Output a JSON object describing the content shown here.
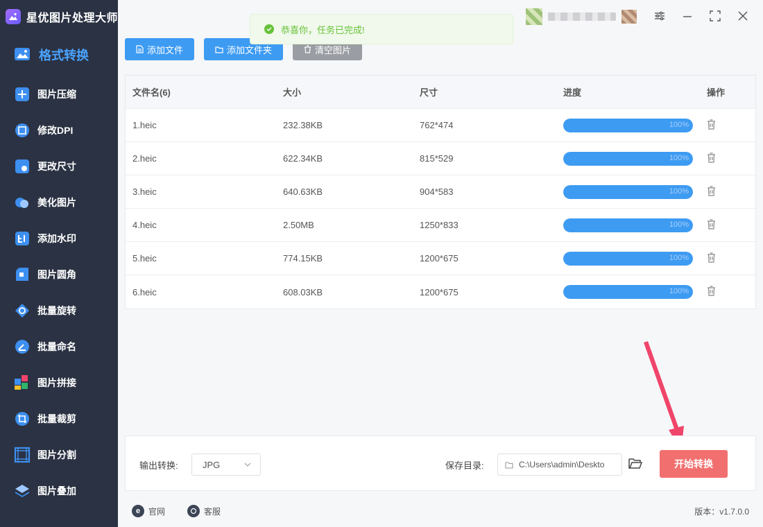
{
  "app": {
    "title": "星优图片处理大师"
  },
  "sidebar": {
    "items": [
      {
        "label": "格式转换",
        "icon": "image-convert-icon",
        "color": "#4aa3ff"
      },
      {
        "label": "图片压缩",
        "icon": "image-compress-icon",
        "color": "#3d9bf2"
      },
      {
        "label": "修改DPI",
        "icon": "dpi-icon",
        "color": "#3d9bf2"
      },
      {
        "label": "更改尺寸",
        "icon": "resize-icon",
        "color": "#3d9bf2"
      },
      {
        "label": "美化图片",
        "icon": "beautify-icon",
        "color": "#3d9bf2"
      },
      {
        "label": "添加水印",
        "icon": "watermark-icon",
        "color": "#3d9bf2"
      },
      {
        "label": "图片圆角",
        "icon": "rounded-corner-icon",
        "color": "#3d9bf2"
      },
      {
        "label": "批量旋转",
        "icon": "rotate-icon",
        "color": "#3d9bf2"
      },
      {
        "label": "批量命名",
        "icon": "rename-icon",
        "color": "#3d9bf2"
      },
      {
        "label": "图片拼接",
        "icon": "puzzle-icon",
        "color": "#3d9bf2"
      },
      {
        "label": "批量裁剪",
        "icon": "crop-icon",
        "color": "#3d9bf2"
      },
      {
        "label": "图片分割",
        "icon": "split-icon",
        "color": "#3d9bf2"
      },
      {
        "label": "图片叠加",
        "icon": "layers-icon",
        "color": "#3d9bf2"
      }
    ]
  },
  "toast": {
    "message": "恭喜你，任务已完成!"
  },
  "toolbar": {
    "add_file": "添加文件",
    "add_folder": "添加文件夹",
    "clear": "清空图片"
  },
  "table": {
    "headers": {
      "name": "文件名(6)",
      "size": "大小",
      "dimensions": "尺寸",
      "progress": "进度",
      "action": "操作"
    },
    "rows": [
      {
        "name": "1.heic",
        "size": "232.38KB",
        "dimensions": "762*474",
        "progress": "100%"
      },
      {
        "name": "2.heic",
        "size": "622.34KB",
        "dimensions": "815*529",
        "progress": "100%"
      },
      {
        "name": "3.heic",
        "size": "640.63KB",
        "dimensions": "904*583",
        "progress": "100%"
      },
      {
        "name": "4.heic",
        "size": "2.50MB",
        "dimensions": "1250*833",
        "progress": "100%"
      },
      {
        "name": "5.heic",
        "size": "774.15KB",
        "dimensions": "1200*675",
        "progress": "100%"
      },
      {
        "name": "6.heic",
        "size": "608.03KB",
        "dimensions": "1200*675",
        "progress": "100%"
      }
    ]
  },
  "output": {
    "format_label": "输出转换:",
    "format_value": "JPG",
    "dir_label": "保存目录:",
    "dir_value": "C:\\Users\\admin\\Deskto",
    "start_label": "开始转换"
  },
  "footer": {
    "website": "官网",
    "service": "客服",
    "version": "版本：v1.7.0.0"
  },
  "colors": {
    "accent": "#3d9bf2",
    "danger": "#f26f6f",
    "success": "#67c23a",
    "sidebar_bg": "#2b3243"
  }
}
